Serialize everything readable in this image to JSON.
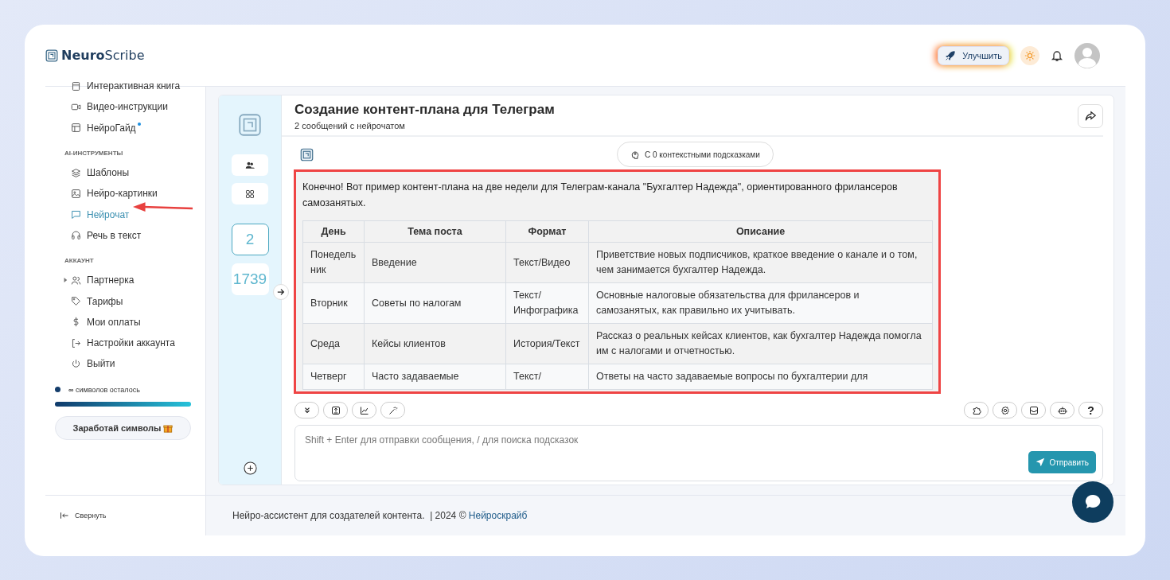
{
  "header": {
    "logo": "**Neuro**Scribe",
    "upgrade_button": "Улучшить"
  },
  "sidebar": {
    "sections": [
      {
        "items": [
          {
            "label": "Интерактивная книга",
            "selected": false,
            "new": false
          },
          {
            "label": "Видео-инструкции",
            "selected": false,
            "new": false
          },
          {
            "label": "НейроГайд",
            "selected": false,
            "new": true
          }
        ]
      },
      {
        "title": "AI-ИНСТРУМЕНТЫ",
        "items": [
          {
            "label": "Шаблоны",
            "selected": false,
            "new": false
          },
          {
            "label": "Нейро-картинки",
            "selected": false,
            "new": false
          },
          {
            "label": "Нейрочат",
            "selected": true,
            "new": false
          },
          {
            "label": "Речь в текст",
            "selected": false,
            "new": false
          }
        ]
      },
      {
        "title": "АККАУНТ",
        "items": [
          {
            "label": "Партнерка",
            "selected": false,
            "new": false,
            "expanded": false
          },
          {
            "label": "Тарифы",
            "selected": false,
            "new": false
          },
          {
            "label": "Мои оплаты",
            "selected": false,
            "new": false
          },
          {
            "label": "Настройки аккаунта",
            "selected": false,
            "new": false
          },
          {
            "label": "Выйти",
            "selected": false,
            "new": false
          }
        ]
      }
    ],
    "symbols": {
      "label": "**∞** символов осталось",
      "level": 1
    },
    "earn_button": "Заработай символы",
    "collapse": "Свернуть"
  },
  "chat": {
    "counters": [
      {
        "value": "2",
        "selected": true
      },
      {
        "value": "1739",
        "selected": false
      }
    ],
    "title": "Создание контент-плана для Телеграм",
    "subtitle": "2 сообщений с нейрочатом",
    "context_pill": "С 0 контекстными подсказками",
    "message": {
      "intro": "Конечно! Вот пример контент-плана на две недели для Телеграм-канала \"Бухгалтер Надежда\", ориентированного фрилансеров самозанятых.",
      "table": {
        "columns": [
          "День",
          "Тема поста",
          "Формат",
          "Описание"
        ],
        "rows": [
          [
            "Понедельник",
            "Введение",
            "Текст/Видео",
            "Приветствие новых подписчиков, краткое введение о канале и о том, чем занимается бухгалтер Надежда."
          ],
          [
            "Вторник",
            "Советы по налогам",
            "Текст/Инфографика",
            "Основные налоговые обязательства для фрилансеров и самозанятых, как правильно их учитывать."
          ],
          [
            "Среда",
            "Кейсы клиентов",
            "История/Текст",
            "Рассказ о реальных кейсах клиентов, как бухгалтер Надежда помогла им с налогами и отчетностью."
          ],
          [
            "Четверг",
            "Часто задаваемые",
            "Текст/",
            "Ответы на часто задаваемые вопросы по бухгалтерии для"
          ]
        ]
      }
    },
    "help_button": "?",
    "input": {
      "placeholder": "Shift + Enter для отправки сообщения, / для поиска подсказок"
    },
    "send_button": "Отправить"
  },
  "footer": {
    "text": "Нейро-ассистент для создателей контента.  | 2024 © ",
    "link": "Нейроскрайб"
  }
}
